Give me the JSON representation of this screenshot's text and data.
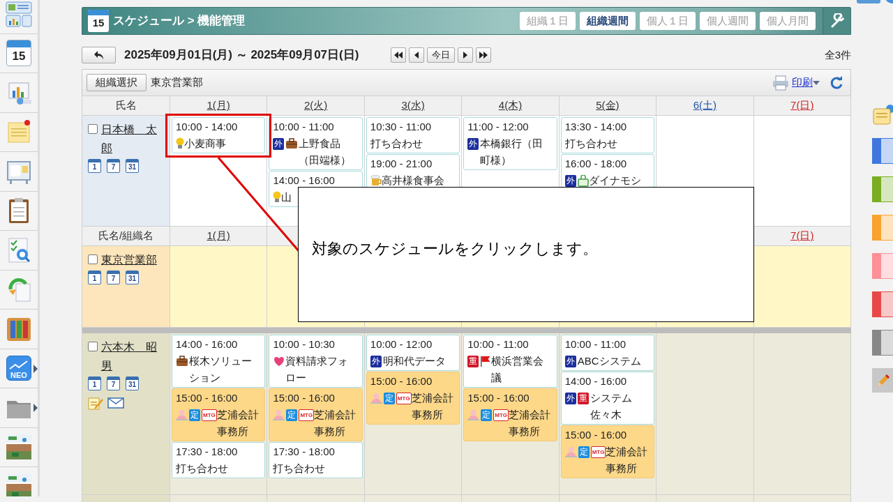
{
  "sidebar": [
    {
      "kind": "dashboard",
      "submenu": false
    },
    {
      "kind": "calendar",
      "label": "15",
      "submenu": false
    },
    {
      "kind": "chart",
      "submenu": false
    },
    {
      "kind": "note",
      "submenu": false
    },
    {
      "kind": "board",
      "submenu": false
    },
    {
      "kind": "clipboard",
      "submenu": false
    },
    {
      "kind": "survey",
      "submenu": false
    },
    {
      "kind": "sync",
      "submenu": false
    },
    {
      "kind": "binders",
      "submenu": false
    },
    {
      "kind": "neo",
      "label": "NEO",
      "submenu": true
    },
    {
      "kind": "folder",
      "submenu": true
    },
    {
      "kind": "picture",
      "submenu": false
    },
    {
      "kind": "picture",
      "submenu": false
    }
  ],
  "header": {
    "icon_label": "15",
    "title": "スケジュール > 機能管理"
  },
  "view_tabs": [
    {
      "label": "組織１日",
      "selected": false
    },
    {
      "label": "組織週間",
      "selected": true
    },
    {
      "label": "個人１日",
      "selected": false
    },
    {
      "label": "個人週間",
      "selected": false
    },
    {
      "label": "個人月間",
      "selected": false
    }
  ],
  "date_range": "2025年09月01日(月) ～ 2025年09月07日(日)",
  "nav": [
    {
      "kind": "first"
    },
    {
      "kind": "prev"
    },
    {
      "kind": "today",
      "label": "今日"
    },
    {
      "kind": "next"
    },
    {
      "kind": "last"
    }
  ],
  "count": "全3件",
  "toolbar": {
    "select_button": "組織選択",
    "organization": "東京営業部",
    "print": "印刷"
  },
  "header1": {
    "name_label": "氏名",
    "days": [
      {
        "label": "1(月)",
        "kind": "weekday"
      },
      {
        "label": "2(火)",
        "kind": "weekday"
      },
      {
        "label": "3(水)",
        "kind": "weekday"
      },
      {
        "label": "4(木)",
        "kind": "weekday"
      },
      {
        "label": "5(金)",
        "kind": "weekday"
      },
      {
        "label": "6(土)",
        "kind": "saturday"
      },
      {
        "label": "7(日)",
        "kind": "sunday"
      }
    ]
  },
  "header2": {
    "name_label": "氏名/組織名",
    "first_day": {
      "label": "1(月)",
      "kind": "weekday"
    },
    "last_day": {
      "label": "7(日)",
      "kind": "sunday"
    }
  },
  "rows": [
    {
      "kind": "self",
      "name": "日本橋　太郎",
      "checked": false,
      "views": [
        "1",
        "7",
        "31"
      ],
      "days": [
        [
          {
            "time": "10:00 - 14:00",
            "title": "小麦商事",
            "marks": [
              {
                "kind": "bulb"
              }
            ],
            "highlighted": false
          }
        ],
        [
          {
            "time": "10:00 - 11:00",
            "title": "上野食品（田端様）",
            "marks": [
              {
                "kind": "badge",
                "text": "外",
                "color": "#1c2f9e"
              },
              {
                "kind": "bag"
              }
            ],
            "highlighted": false
          },
          {
            "time": "14:00 - 16:00",
            "title": "山",
            "marks": [
              {
                "kind": "bulb"
              }
            ],
            "highlighted": false
          }
        ],
        [
          {
            "time": "10:30 - 11:00",
            "title": "打ち合わせ",
            "highlighted": false
          },
          {
            "time": "19:00 - 21:00",
            "title": "高井様食事会",
            "marks": [
              {
                "kind": "mug"
              }
            ],
            "highlighted": false
          }
        ],
        [
          {
            "time": "11:00 - 12:00",
            "title": "本橋銀行（田町様）",
            "marks": [
              {
                "kind": "badge",
                "text": "外",
                "color": "#1c2f9e"
              }
            ],
            "highlighted": false
          }
        ],
        [
          {
            "time": "13:30 - 14:00",
            "title": "打ち合わせ",
            "highlighted": false
          },
          {
            "time": "16:00 - 18:00",
            "title": "ダイナモシ",
            "marks": [
              {
                "kind": "badge",
                "text": "外",
                "color": "#1c2f9e"
              },
              {
                "kind": "shop"
              }
            ],
            "highlighted": false
          }
        ]
      ]
    },
    {
      "kind": "organization",
      "name": "東京営業部",
      "checked": false,
      "views": [
        "1",
        "7",
        "31"
      ]
    },
    {
      "kind": "member",
      "name": "六本木　昭男",
      "checked": false,
      "views": [
        "1",
        "7",
        "31"
      ],
      "actions": [
        {
          "kind": "memo"
        },
        {
          "kind": "mail"
        }
      ],
      "days": [
        [
          {
            "time": "14:00 - 16:00",
            "title": "桜木ソリューション",
            "marks": [
              {
                "kind": "bag"
              }
            ],
            "highlighted": false
          },
          {
            "time": "15:00 - 16:00",
            "title": "芝浦会計事務所",
            "marks": [
              {
                "kind": "figure"
              },
              {
                "kind": "badge",
                "text": "定",
                "color": "#1a8ee0"
              },
              {
                "kind": "outline",
                "text": "MTG",
                "color": "#d8232a"
              }
            ],
            "highlighted": true
          },
          {
            "time": "17:30 - 18:00",
            "title": "打ち合わせ",
            "highlighted": false
          }
        ],
        [
          {
            "time": "10:00 - 10:30",
            "title": "資料請求フォロー",
            "marks": [
              {
                "kind": "heart"
              }
            ],
            "highlighted": false
          },
          {
            "time": "15:00 - 16:00",
            "title": "芝浦会計事務所",
            "marks": [
              {
                "kind": "figure"
              },
              {
                "kind": "badge",
                "text": "定",
                "color": "#1a8ee0"
              },
              {
                "kind": "outline",
                "text": "MTG",
                "color": "#d8232a"
              }
            ],
            "highlighted": true
          },
          {
            "time": "17:30 - 18:00",
            "title": "打ち合わせ",
            "highlighted": false
          }
        ],
        [
          {
            "time": "10:00 - 12:00",
            "title": "明和代データ",
            "marks": [
              {
                "kind": "badge",
                "text": "外",
                "color": "#1c2f9e"
              }
            ],
            "highlighted": false
          },
          {
            "time": "15:00 - 16:00",
            "title": "芝浦会計事務所",
            "marks": [
              {
                "kind": "figure"
              },
              {
                "kind": "badge",
                "text": "定",
                "color": "#1a8ee0"
              },
              {
                "kind": "outline",
                "text": "MTG",
                "color": "#d8232a"
              }
            ],
            "highlighted": true
          }
        ],
        [
          {
            "time": "10:00 - 11:00",
            "title": "横浜営業会議",
            "marks": [
              {
                "kind": "badge",
                "text": "重",
                "color": "#d0182a"
              },
              {
                "kind": "flag"
              }
            ],
            "highlighted": false
          },
          {
            "time": "15:00 - 16:00",
            "title": "芝浦会計事務所",
            "marks": [
              {
                "kind": "figure"
              },
              {
                "kind": "badge",
                "text": "定",
                "color": "#1a8ee0"
              },
              {
                "kind": "outline",
                "text": "MTG",
                "color": "#d8232a"
              }
            ],
            "highlighted": true
          }
        ],
        [
          {
            "time": "10:00 - 11:00",
            "title": "ABCシステム",
            "marks": [
              {
                "kind": "badge",
                "text": "外",
                "color": "#1c2f9e"
              }
            ],
            "highlighted": false
          },
          {
            "time": "14:00 - 16:00",
            "title": "システム佐々木",
            "marks": [
              {
                "kind": "badge",
                "text": "外",
                "color": "#1c2f9e"
              },
              {
                "kind": "badge",
                "text": "重",
                "color": "#d0182a"
              }
            ],
            "highlighted": false
          },
          {
            "time": "15:00 - 16:00",
            "title": "芝浦会計事務所",
            "marks": [
              {
                "kind": "figure"
              },
              {
                "kind": "badge",
                "text": "定",
                "color": "#1a8ee0"
              },
              {
                "kind": "outline",
                "text": "MTG",
                "color": "#d8232a"
              }
            ],
            "highlighted": true
          }
        ]
      ]
    }
  ],
  "palette": [
    {
      "color": "#3f77df"
    },
    {
      "color": "#7aad22"
    },
    {
      "color": "#f9a22e"
    },
    {
      "color": "#fc8f98"
    },
    {
      "color": "#e84848"
    },
    {
      "color": "#888888"
    }
  ],
  "callout": {
    "text": "対象のスケジュールをクリックします。"
  }
}
